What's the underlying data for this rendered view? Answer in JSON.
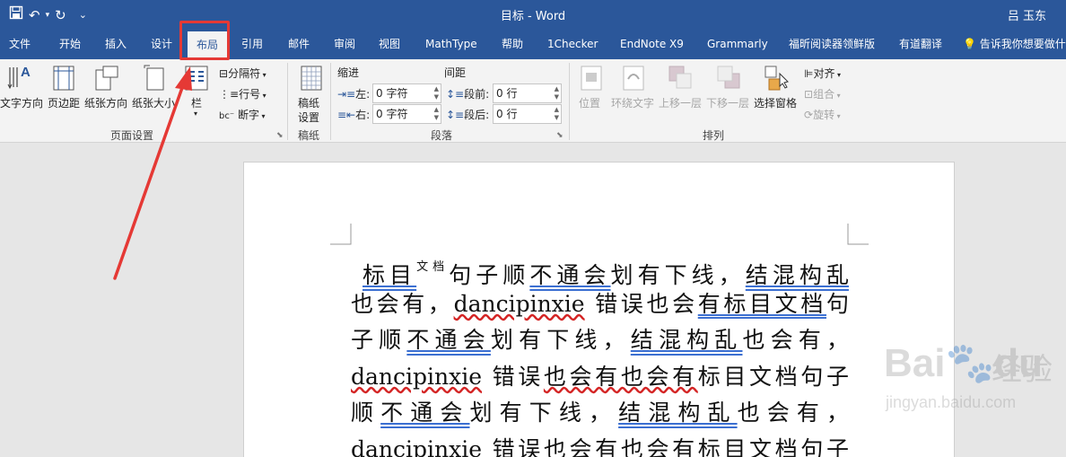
{
  "window": {
    "title": "目标 - Word",
    "user": "吕 玉东"
  },
  "qat": {
    "save_icon": "save-icon",
    "undo": "↶",
    "redo": "↻",
    "more": "⌄"
  },
  "tabs": [
    {
      "label": "文件"
    },
    {
      "label": "开始"
    },
    {
      "label": "插入"
    },
    {
      "label": "设计"
    },
    {
      "label": "布局"
    },
    {
      "label": "引用"
    },
    {
      "label": "邮件"
    },
    {
      "label": "审阅"
    },
    {
      "label": "视图"
    },
    {
      "label": "MathType"
    },
    {
      "label": "帮助"
    },
    {
      "label": "1Checker"
    },
    {
      "label": "EndNote X9"
    },
    {
      "label": "Grammarly"
    },
    {
      "label": "福昕阅读器领鲜版"
    },
    {
      "label": "有道翻译"
    }
  ],
  "active_tab": "布局",
  "tell_me": "告诉我你想要做什",
  "ribbon": {
    "page_setup": {
      "label": "页面设置",
      "text_direction": "文字方向",
      "margins": "页边距",
      "orientation": "纸张方向",
      "size": "纸张大小",
      "columns": "栏",
      "breaks": "分隔符",
      "line_numbers": "行号",
      "hyphenation": "断字"
    },
    "manuscript": {
      "label": "稿纸",
      "button_line1": "稿纸",
      "button_line2": "设置"
    },
    "paragraph": {
      "label": "段落",
      "indent_heading": "缩进",
      "spacing_heading": "间距",
      "left_label": "左:",
      "left_value": "0 字符",
      "right_label": "右:",
      "right_value": "0 字符",
      "before_label": "段前:",
      "before_value": "0 行",
      "after_label": "段后:",
      "after_value": "0 行"
    },
    "arrange": {
      "label": "排列",
      "position": "位置",
      "wrap_text": "环绕文字",
      "bring_forward": "上移一层",
      "send_backward": "下移一层",
      "selection_pane": "选择窗格",
      "align": "对齐",
      "group": "组合",
      "rotate": "旋转"
    }
  },
  "document": {
    "lines": {
      "l1_a": "标目",
      "l1_sup": "文档",
      "l1_b": "句子顺",
      "l1_c": "不通会",
      "l1_d": "划有下线，",
      "l1_e": "结混构乱",
      "l2_a": "也会有，",
      "l2_b": "dancipinxie",
      "l2_c": " 错误也会",
      "l2_d": "有标目文档",
      "l2_e": "句",
      "l3_a": "子顺",
      "l3_b": "不通会",
      "l3_c": "划有下线，",
      "l3_d": "结混构乱",
      "l3_e": "也会有，",
      "l4_a": "dancipinxie",
      "l4_b": " 错误",
      "l4_c": "也会有也会有",
      "l4_d": "标目文档句子",
      "l5_a": "顺",
      "l5_b": "不通会",
      "l5_c": "划有下线，",
      "l5_d": "结混构乱",
      "l5_e": "也会有，",
      "l6_a": "dancipinxie",
      "l6_b": " 错误也会有也会有标目文档句子"
    }
  },
  "watermark": {
    "logo": "Bai",
    "logo2": "du",
    "cn": "经验",
    "url": "jingyan.baidu.com"
  },
  "colors": {
    "titlebar": "#2b579a",
    "ribbon": "#f3f3f3",
    "highlight": "#e53935"
  }
}
